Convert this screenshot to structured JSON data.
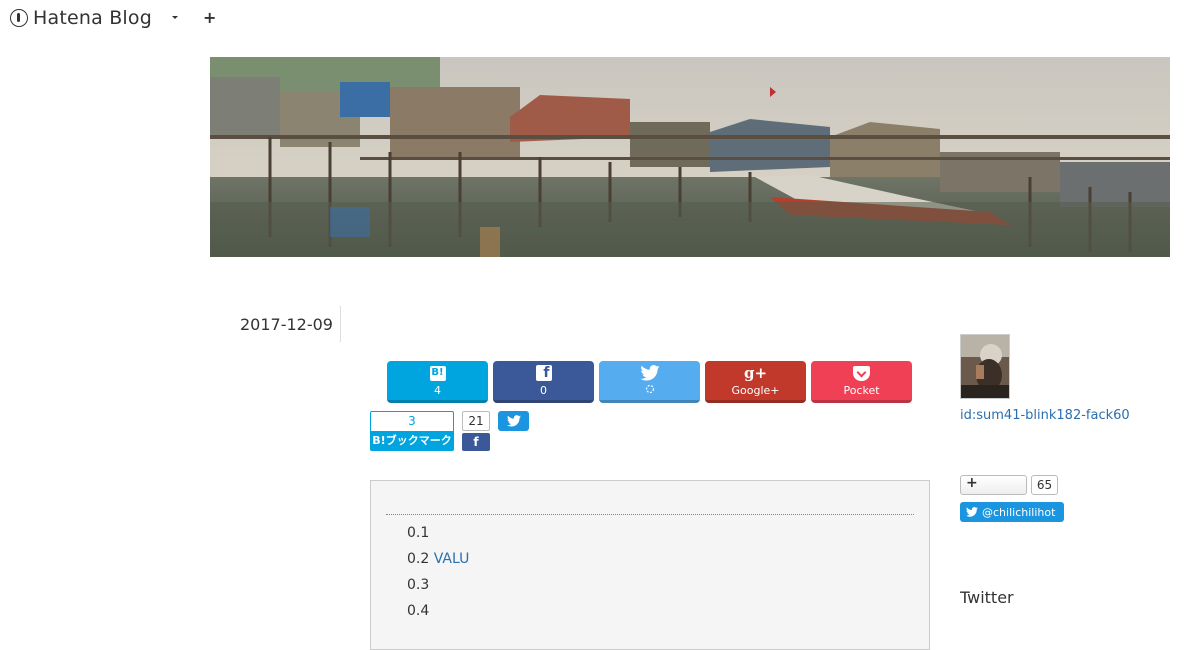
{
  "brand": {
    "name": "Hatena Blog"
  },
  "topbar": {
    "add_label": "+"
  },
  "post": {
    "date": "2017-12-09"
  },
  "share_buttons": [
    {
      "id": "hatena",
      "icon": "hatena-bookmark-icon",
      "icon_text": "B!",
      "label": "4",
      "color": "#00a4de"
    },
    {
      "id": "facebook",
      "icon": "facebook-icon",
      "icon_text": "f",
      "label": "0",
      "color": "#3b5998"
    },
    {
      "id": "twitter",
      "icon": "twitter-bird-icon",
      "label": "",
      "color": "#55acee"
    },
    {
      "id": "googleplus",
      "icon": "google-plus-icon",
      "icon_text": "g+",
      "label": "Google+",
      "color": "#c0392b"
    },
    {
      "id": "pocket",
      "icon": "pocket-icon",
      "label": "Pocket",
      "color": "#ef4056"
    }
  ],
  "small_share": {
    "hatena_count": "3",
    "hatena_label": "B!ブックマーク",
    "facebook_count": "21",
    "facebook_icon_text": "f"
  },
  "toc": {
    "items": [
      {
        "num": "0.1",
        "text": ""
      },
      {
        "num": "0.2",
        "text": "VALU"
      },
      {
        "num": "0.3",
        "text": ""
      },
      {
        "num": "0.4",
        "text": ""
      }
    ]
  },
  "sidebar": {
    "user_id": "id:sum41-blink182-fack60",
    "follow_plus": "+",
    "follow_count": "65",
    "twitter_handle": "@chilichilihot",
    "section_title": "Twitter"
  }
}
